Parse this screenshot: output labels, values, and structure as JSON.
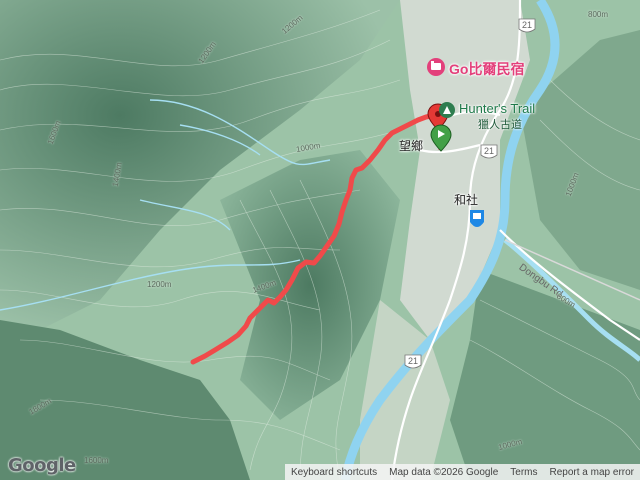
{
  "map": {
    "pois": {
      "bnb_name": "Go比爾民宿",
      "trail_name": "Hunter's Trail",
      "trail_subname": "獵人古道"
    },
    "places": {
      "wangxiang": "望鄉",
      "heshe": "和社"
    },
    "roads": {
      "route_21_a": "21",
      "route_21_b": "21",
      "route_21_c": "21",
      "dongbu_rd": "Dongbu Rd"
    },
    "contours": {
      "c1200_top": "1200m",
      "c1400_left": "1400m",
      "c1600_left": "1600m",
      "c1000_mid": "1000m",
      "c1200_mid": "1200m",
      "c1400_mid": "1400m",
      "c800_top": "800m",
      "c800_east": "800m",
      "c1000_east": "1000m",
      "c1800_bottom": "1800m",
      "c1600_bottom": "1600m",
      "c1000_bottom": "1000m",
      "c1200_small": "1200m"
    },
    "colors": {
      "route": "#f04a4a",
      "river": "#8fd3f0",
      "poi_pink": "#e3407b",
      "poi_green": "#1f7a4a"
    }
  },
  "footer": {
    "google": "Google",
    "shortcuts": "Keyboard shortcuts",
    "map_data": "Map data ©2026 Google",
    "terms": "Terms",
    "report": "Report a map error"
  }
}
